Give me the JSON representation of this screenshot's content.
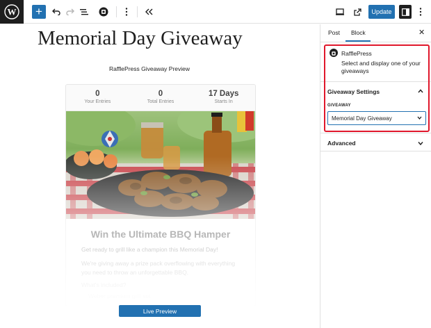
{
  "toolbar": {
    "update_label": "Update",
    "icons": [
      "wordpress-icon",
      "add-block-icon",
      "undo-icon",
      "redo-icon",
      "list-view-icon",
      "rafflepress-icon",
      "more-options-icon",
      "collapse-icon",
      "desktop-preview-icon",
      "external-view-icon",
      "sidebar-toggle-icon",
      "kebab-menu-icon"
    ]
  },
  "canvas": {
    "page_title": "Memorial Day Giveaway",
    "preview_label": "RafflePress Giveaway Preview",
    "stats": [
      {
        "value": "0",
        "label": "Your Entries"
      },
      {
        "value": "0",
        "label": "Total Entries"
      },
      {
        "value": "17 Days",
        "label": "Starts In"
      }
    ],
    "giveaway_title": "Win the Ultimate BBQ Hamper",
    "intro": "Get ready to grill like a champion this Memorial Day!",
    "body": "We're giving away a prize pack overflowing with everything you need to throw an unforgettable BBQ.",
    "included_heading": "What's included?",
    "included_first": "Weber premium grill set",
    "live_preview_label": "Live Preview"
  },
  "sidebar": {
    "tab_post": "Post",
    "tab_block": "Block",
    "close_glyph": "✕",
    "block_name": "RafflePress",
    "block_desc": "Select and display one of your giveaways",
    "settings_title": "Giveaway Settings",
    "giveaway_label": "GIVEAWAY",
    "selected_giveaway": "Memorial Day Giveaway",
    "advanced_title": "Advanced"
  },
  "colors": {
    "accent": "#2271b1",
    "highlight": "#e0172b",
    "dark": "#1e1e1e"
  }
}
